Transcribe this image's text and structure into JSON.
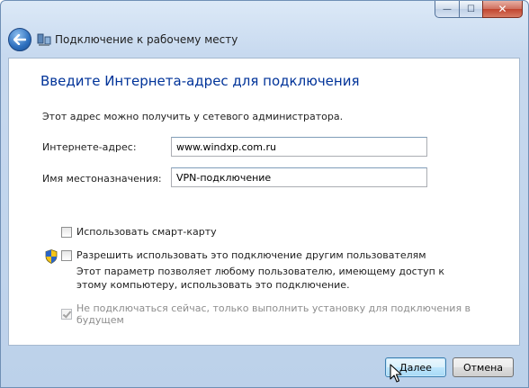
{
  "window": {
    "minimize_label": "—",
    "maximize_label": "☐",
    "close_label": "✕"
  },
  "nav": {
    "title": "Подключение к рабочему месту"
  },
  "page": {
    "heading": "Введите Интернета-адрес для подключения",
    "info": "Этот адрес можно получить у сетевого администратора."
  },
  "form": {
    "address_label": "Интернете-адрес:",
    "address_value": "www.windxp.com.ru",
    "name_label": "Имя местоназначения:",
    "name_value": "VPN-подключение"
  },
  "options": {
    "smartcard_label": "Использовать смарт-карту",
    "share_label": "Разрешить использовать это подключение другим пользователям",
    "share_description": "Этот параметр позволяет любому пользователю, имеющему доступ к этому компьютеру, использовать это подключение.",
    "defer_label": "Не подключаться сейчас, только выполнить установку для подключения в будущем",
    "smartcard_checked": false,
    "share_checked": false,
    "defer_checked": true
  },
  "buttons": {
    "next_label": "Далее",
    "cancel_label": "Отмена"
  },
  "colors": {
    "heading": "#003399",
    "accent": "#2d6fbe"
  }
}
